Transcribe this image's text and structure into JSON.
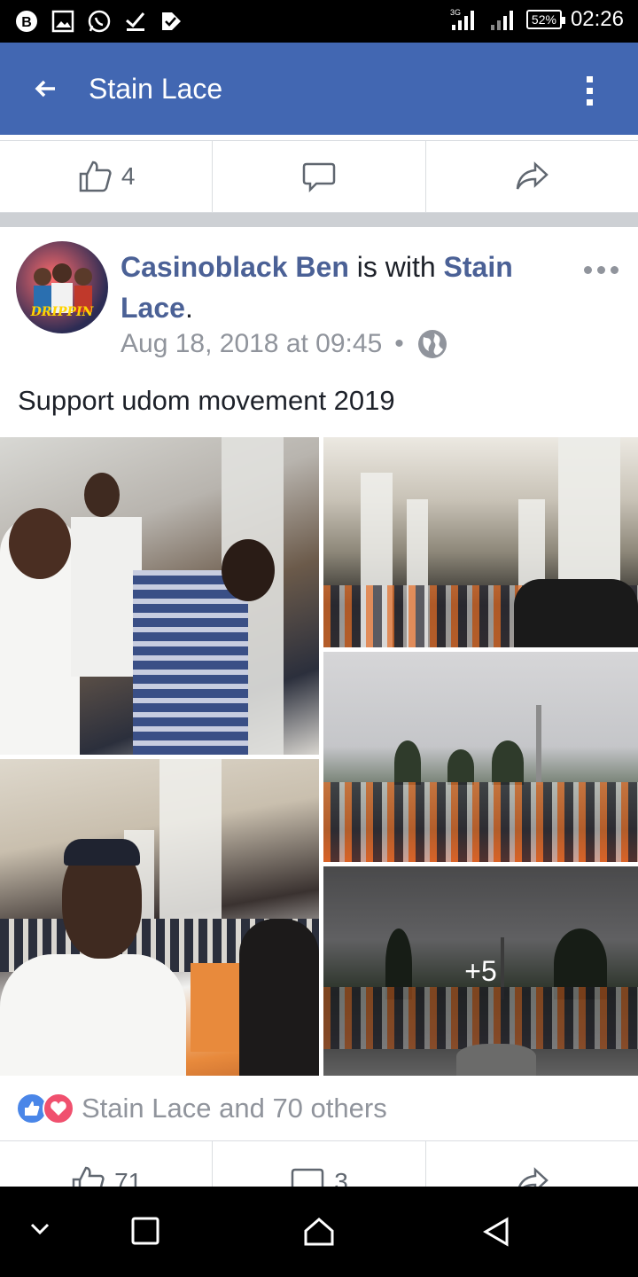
{
  "status_bar": {
    "time": "02:26",
    "battery": "52%",
    "network_label": "3G"
  },
  "app_bar": {
    "title": "Stain Lace",
    "back_icon": "arrow-left-icon",
    "menu_icon": "vertical-dots-icon"
  },
  "top_actions": {
    "like_count": "4"
  },
  "post": {
    "author": "Casinoblack Ben",
    "with_text": " is with ",
    "tagged": "Stain",
    "tagged_cont": "Lace",
    "period": ".",
    "date": "Aug 18, 2018 at 09:45",
    "separator": "•",
    "privacy_icon": "globe-icon",
    "avatar_text": "DRIPPIN",
    "text": "Support udom movement 2019",
    "more_photos": "+5",
    "reactions_text": "Stain Lace and 70 others",
    "like_count": "71",
    "comment_count": "3"
  },
  "colors": {
    "app_bar": "#4267b2",
    "link": "#4b6196",
    "muted": "#90949c",
    "like": "#4a86e8",
    "love": "#f0506e"
  }
}
